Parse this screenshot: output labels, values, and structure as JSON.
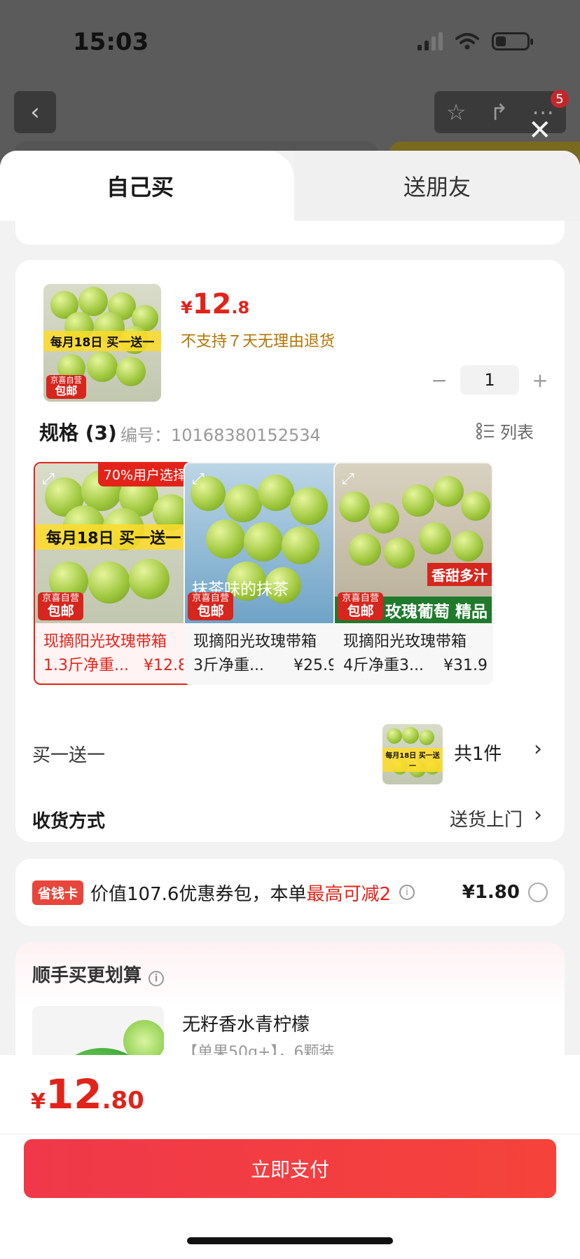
{
  "status": {
    "time": "15:03"
  },
  "header": {
    "cart_badge": "5"
  },
  "tabs": {
    "self": "自己买",
    "friend": "送朋友"
  },
  "product": {
    "price_symbol": "¥",
    "price_int": "12",
    "price_dec": ".8",
    "return_policy": "不支持７天无理由退货",
    "quantity": "1",
    "thumb_ribbon": "每月18日 买一送一",
    "thumb_tag_top": "京喜自营",
    "thumb_tag_bottom": "包邮"
  },
  "spec": {
    "title": "规格 (3)",
    "code": "编号：10168380152534",
    "list_label": "列表",
    "options": [
      {
        "name_line1": "现摘阳光玫瑰带箱",
        "name_line2": "1.3斤净重...",
        "price": "¥12.8",
        "badge": "70%用户选择",
        "ribbon": "每月18日 买一送一",
        "tag_top": "京喜自营",
        "tag_bottom": "包邮",
        "selected": true
      },
      {
        "name_line1": "现摘阳光玫瑰带箱",
        "name_line2": "3斤净重...",
        "price": "¥25.9",
        "overlay": "抹茶味的抹茶",
        "tag_top": "京喜自营",
        "tag_bottom": "包邮",
        "selected": false
      },
      {
        "name_line1": "现摘阳光玫瑰带箱",
        "name_line2": "4斤净重3...",
        "price": "¥31.9",
        "label_top": "香甜多汁",
        "label_bottom": "玫瑰葡萄 精品",
        "tag_top": "京喜自营",
        "tag_bottom": "包邮",
        "selected": false
      }
    ]
  },
  "bogo": {
    "label": "买一送一",
    "count": "共1件"
  },
  "shipping": {
    "label": "收货方式",
    "value": "送货上门"
  },
  "coupon": {
    "tag": "省钱卡",
    "text": "价值107.6优惠券包，本单",
    "highlight": "最高可减2",
    "amount": "¥1.80"
  },
  "addon": {
    "title": "顺手买更划算",
    "item_name": "无籽香水青柠檬",
    "item_spec": "【单果50g+】，6颗装"
  },
  "footer": {
    "total_symbol": "¥",
    "total_int": "12",
    "total_dec": ".80",
    "pay_label": "立即支付"
  }
}
